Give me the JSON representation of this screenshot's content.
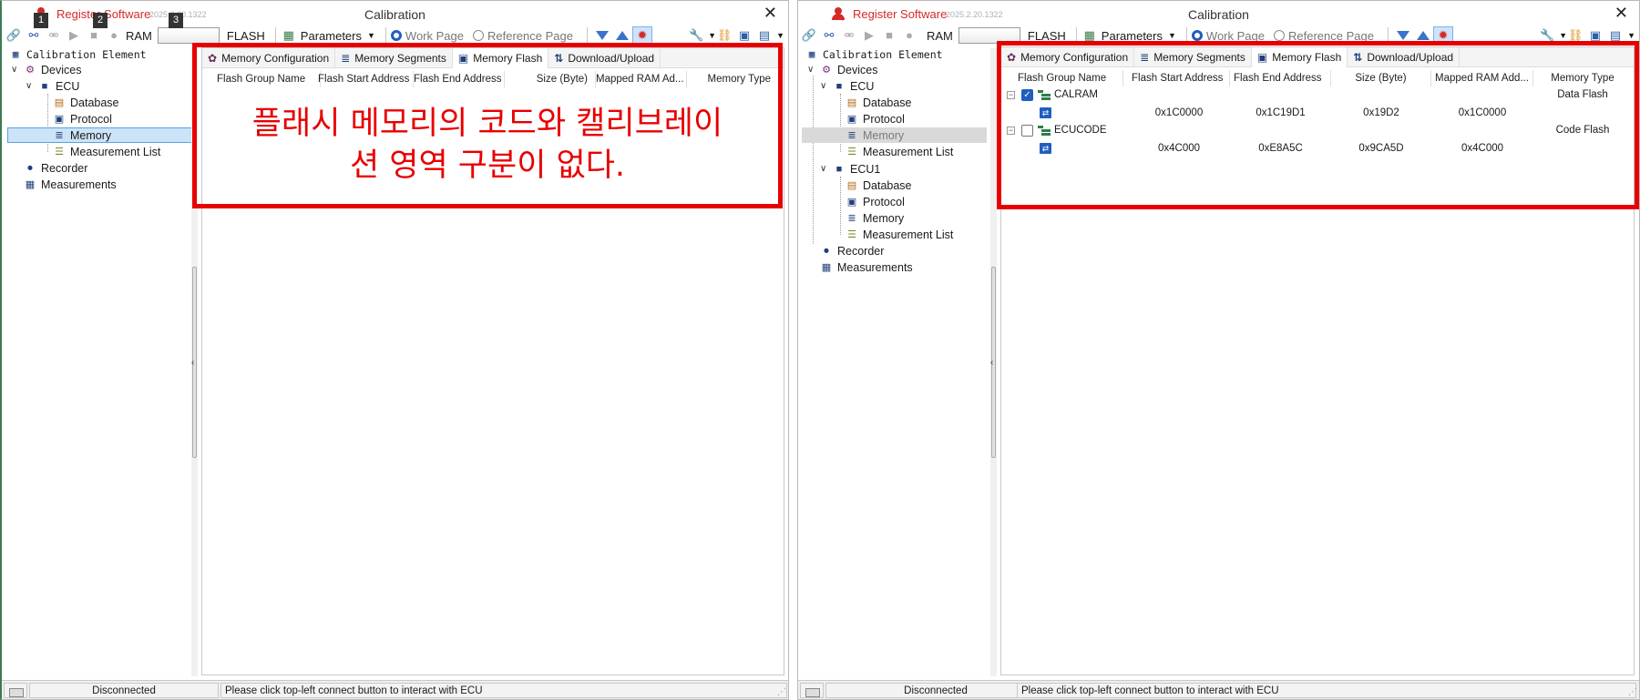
{
  "left": {
    "app_name": "Register Software",
    "version": "2025.2.20.1322",
    "title": "Calibration",
    "close": "✕",
    "badges": [
      "1",
      "2",
      "3"
    ],
    "toolbar": {
      "ram": "RAM",
      "flash": "FLASH",
      "parameters": "Parameters",
      "work_page": "Work Page",
      "reference_page": "Reference Page"
    },
    "tree": {
      "root": "Calibration Element",
      "devices": "Devices",
      "ecu": "ECU",
      "database": "Database",
      "protocol": "Protocol",
      "memory": "Memory",
      "measurement_list": "Measurement List",
      "recorder": "Recorder",
      "measurements": "Measurements"
    },
    "tabs": [
      "Memory Configuration",
      "Memory Segments",
      "Memory Flash",
      "Download/Upload"
    ],
    "columns": [
      "Flash Group Name",
      "Flash Start Address",
      "Flash End Address",
      "Size (Byte)",
      "Mapped RAM Ad...",
      "Memory Type"
    ],
    "annotation_line1": "플래시 메모리의 코드와 캘리브레이",
    "annotation_line2": "션 영역 구분이 없다.",
    "status": {
      "connection": "Disconnected",
      "message": "Please click top-left connect button to interact with ECU"
    }
  },
  "right": {
    "app_name": "Register Software",
    "version": "2025.2.20.1322",
    "title": "Calibration",
    "close": "✕",
    "toolbar": {
      "ram": "RAM",
      "flash": "FLASH",
      "parameters": "Parameters",
      "work_page": "Work Page",
      "reference_page": "Reference Page"
    },
    "tree": {
      "root": "Calibration Element",
      "devices": "Devices",
      "ecu": "ECU",
      "database": "Database",
      "protocol": "Protocol",
      "memory": "Memory",
      "measurement_list": "Measurement List",
      "ecu1": "ECU1",
      "database1": "Database",
      "protocol1": "Protocol",
      "memory1": "Memory",
      "measurement_list1": "Measurement List",
      "recorder": "Recorder",
      "measurements": "Measurements"
    },
    "tabs": [
      "Memory Configuration",
      "Memory Segments",
      "Memory Flash",
      "Download/Upload"
    ],
    "columns": [
      "Flash Group Name",
      "Flash Start Address",
      "Flash End Address",
      "Size (Byte)",
      "Mapped RAM Add...",
      "Memory Type"
    ],
    "rows": [
      {
        "name": "CALRAM",
        "checked": true,
        "memory_type": "Data Flash",
        "start": "0x1C0000",
        "end": "0x1C19D1",
        "size": "0x19D2",
        "mapped": "0x1C0000"
      },
      {
        "name": "ECUCODE",
        "checked": false,
        "memory_type": "Code Flash",
        "start": "0x4C000",
        "end": "0xE8A5C",
        "size": "0x9CA5D",
        "mapped": "0x4C000"
      }
    ],
    "status": {
      "connection": "Disconnected",
      "message": "Please click top-left connect button to interact with ECU"
    }
  },
  "colors": {
    "annotation": "#e80000",
    "brand": "#d42a2a",
    "selection": "#cce4f7"
  }
}
